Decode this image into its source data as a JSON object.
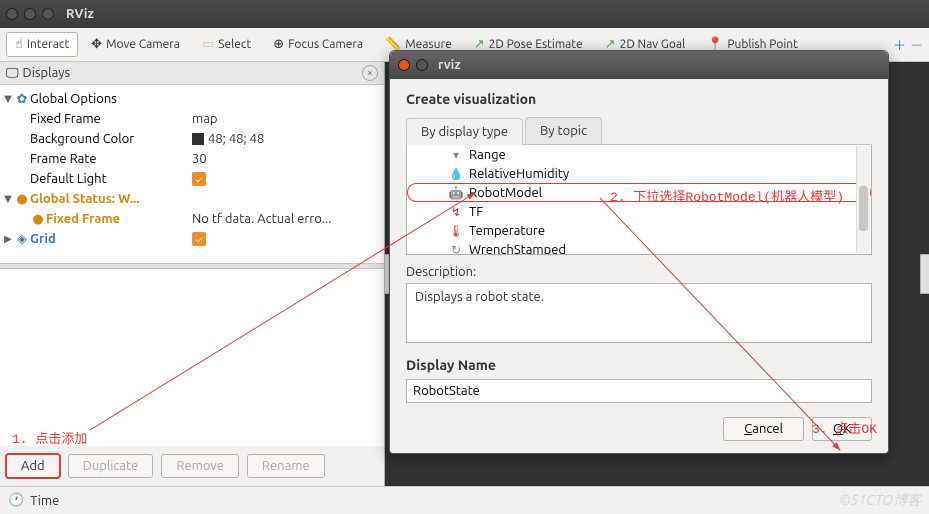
{
  "window": {
    "title": "RViz"
  },
  "toolbar": {
    "interact": "Interact",
    "move_camera": "Move Camera",
    "select": "Select",
    "focus_camera": "Focus Camera",
    "measure": "Measure",
    "pose_2d": "2D Pose Estimate",
    "nav_goal": "2D Nav Goal",
    "publish_point": "Publish Point"
  },
  "displays": {
    "title": "Displays",
    "global_options": "Global Options",
    "fixed_frame_k": "Fixed Frame",
    "fixed_frame_v": "map",
    "bgcolor_k": "Background Color",
    "bgcolor_v": "48; 48; 48",
    "frame_rate_k": "Frame Rate",
    "frame_rate_v": "30",
    "default_light_k": "Default Light",
    "global_status": "Global Status: W...",
    "fixed_frame_status_k": "Fixed Frame",
    "fixed_frame_status_v": "No tf data.  Actual erro...",
    "grid": "Grid"
  },
  "buttons": {
    "add": "Add",
    "duplicate": "Duplicate",
    "remove": "Remove",
    "rename": "Rename"
  },
  "time": {
    "label": "Time"
  },
  "dialog": {
    "title": "rviz",
    "heading": "Create visualization",
    "tab_type": "By display type",
    "tab_topic": "By topic",
    "items": {
      "range": "Range",
      "relhum": "RelativeHumidity",
      "robotmodel": "RobotModel",
      "tf": "TF",
      "temperature": "Temperature",
      "wrench": "WrenchStamped"
    },
    "description_label": "Description:",
    "description_text": "Displays a robot state.",
    "display_name_label": "Display Name",
    "display_name_value": "RobotState",
    "cancel": "Cancel",
    "ok": "OK"
  },
  "annotations": {
    "a1": "1. 点击添加",
    "a2": "2. 下拉选择RobotModel(机器人模型)",
    "a3": "3. 点击OK"
  },
  "watermark": "©51CTO博客"
}
